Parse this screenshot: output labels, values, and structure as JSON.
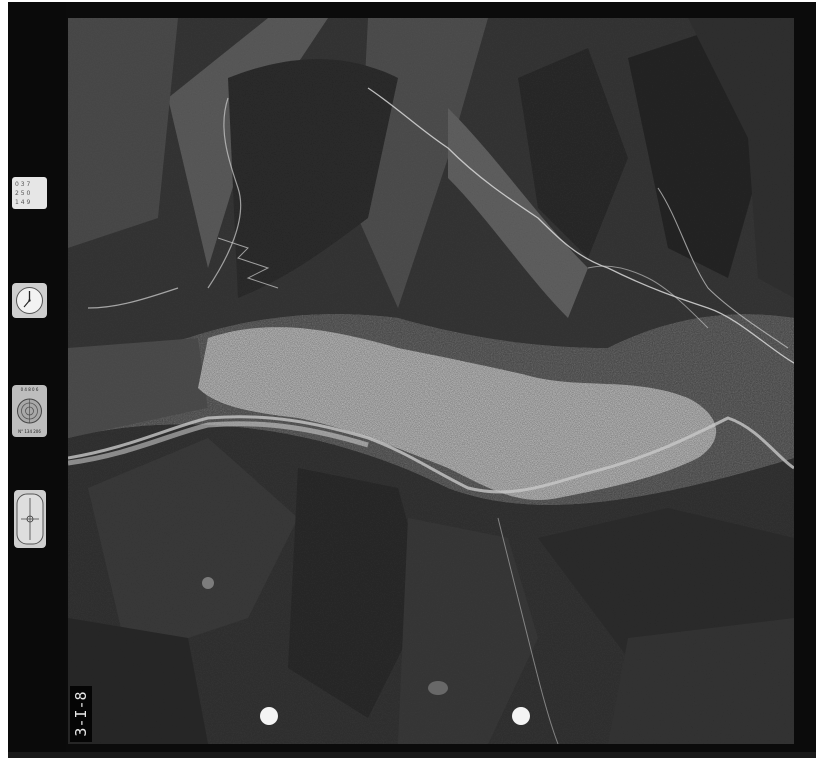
{
  "photo": {
    "type": "aerial photograph",
    "subject": "mountain valley with town along river",
    "frame_label": "3-I-8",
    "counter_text": [
      "0 3 7",
      "2 5 0",
      "1 4 9"
    ],
    "altimeter_text": [
      "0 4 8 0 6",
      "N° 134 206"
    ]
  }
}
